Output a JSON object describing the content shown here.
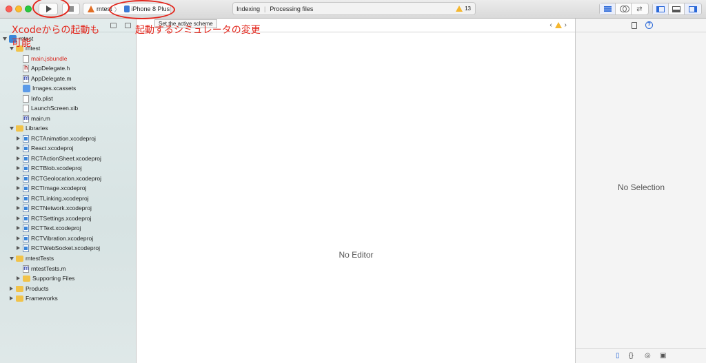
{
  "toolbar": {
    "scheme": "rntest",
    "device": "iPhone 8 Plus",
    "activity_status": "Indexing",
    "activity_detail": "Processing files",
    "warning_count": "13"
  },
  "tooltip": "Set the active scheme",
  "annotations": {
    "run_note_line1": "Xcodeからの起動も",
    "run_note_line2": "可能",
    "device_note": "起動するシミュレータの変更",
    "color": "#e3261c"
  },
  "navigator": {
    "items": [
      {
        "label": "rntest",
        "icon": "project-icon"
      },
      {
        "label": "rntest",
        "icon": "folder-icon"
      },
      {
        "label": "main.jsbundle",
        "icon": "file-icon"
      },
      {
        "label": "AppDelegate.h",
        "icon": "header-file-icon"
      },
      {
        "label": "AppDelegate.m",
        "icon": "objc-file-icon"
      },
      {
        "label": "Images.xcassets",
        "icon": "asset-catalog-icon"
      },
      {
        "label": "Info.plist",
        "icon": "plist-file-icon"
      },
      {
        "label": "LaunchScreen.xib",
        "icon": "xib-file-icon"
      },
      {
        "label": "main.m",
        "icon": "objc-file-icon"
      },
      {
        "label": "Libraries",
        "icon": "folder-icon"
      },
      {
        "label": "RCTAnimation.xcodeproj",
        "icon": "xcodeproj-icon"
      },
      {
        "label": "React.xcodeproj",
        "icon": "xcodeproj-icon"
      },
      {
        "label": "RCTActionSheet.xcodeproj",
        "icon": "xcodeproj-icon"
      },
      {
        "label": "RCTBlob.xcodeproj",
        "icon": "xcodeproj-icon"
      },
      {
        "label": "RCTGeolocation.xcodeproj",
        "icon": "xcodeproj-icon"
      },
      {
        "label": "RCTImage.xcodeproj",
        "icon": "xcodeproj-icon"
      },
      {
        "label": "RCTLinking.xcodeproj",
        "icon": "xcodeproj-icon"
      },
      {
        "label": "RCTNetwork.xcodeproj",
        "icon": "xcodeproj-icon"
      },
      {
        "label": "RCTSettings.xcodeproj",
        "icon": "xcodeproj-icon"
      },
      {
        "label": "RCTText.xcodeproj",
        "icon": "xcodeproj-icon"
      },
      {
        "label": "RCTVibration.xcodeproj",
        "icon": "xcodeproj-icon"
      },
      {
        "label": "RCTWebSocket.xcodeproj",
        "icon": "xcodeproj-icon"
      },
      {
        "label": "rntestTests",
        "icon": "folder-icon"
      },
      {
        "label": "rntestTests.m",
        "icon": "objc-file-icon"
      },
      {
        "label": "Supporting Files",
        "icon": "folder-icon"
      },
      {
        "label": "Products",
        "icon": "folder-icon"
      },
      {
        "label": "Frameworks",
        "icon": "folder-icon"
      }
    ]
  },
  "editor": {
    "empty_text": "No Editor"
  },
  "inspector": {
    "empty_text": "No Selection"
  }
}
